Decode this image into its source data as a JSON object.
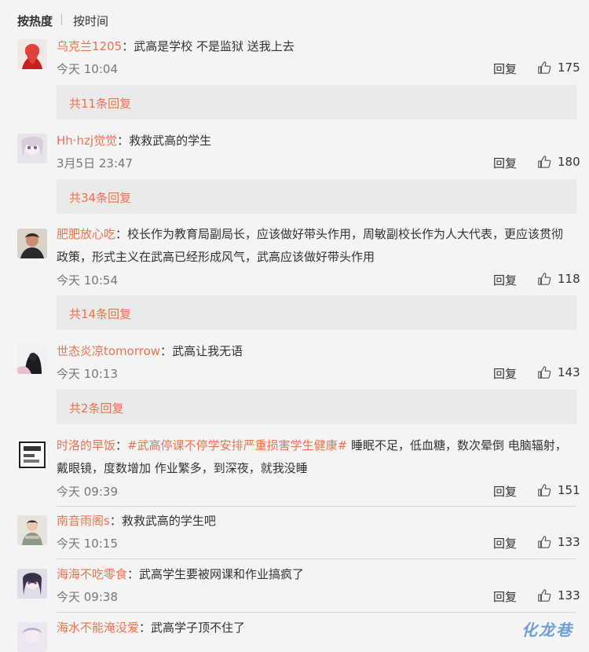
{
  "sort": {
    "hot": "按热度",
    "time": "按时间"
  },
  "reply_label": "回复",
  "icons": {
    "like": "thumbs-up-icon"
  },
  "colors": {
    "username": "#eb7350",
    "replies_bg": "#eaeaea",
    "background": "#f4f4f4"
  },
  "comments": [
    {
      "user": "乌克兰1205",
      "text": "武高是学校 不是监狱 送我上去",
      "time": "今天 10:04",
      "likes": "175",
      "replies": "共11条回复"
    },
    {
      "user": "Hh·hzj觉觉",
      "text": "救救武高的学生",
      "time": "3月5日 23:47",
      "likes": "180",
      "replies": "共34条回复"
    },
    {
      "user": "肥肥放心吃",
      "text_line1": "校长作为教育局副局长，应该做好带头作用，周敏副校长作为人大代表，更应该贯彻",
      "text_line2": "政策，形式主义在武高已经形成风气，武高应该做好带头作用",
      "time": "今天 10:54",
      "likes": "118",
      "replies": "共14条回复"
    },
    {
      "user": "世态炎凉tomorrow",
      "text": "武高让我无语",
      "time": "今天 10:13",
      "likes": "143",
      "replies": "共2条回复"
    },
    {
      "user": "时洛的早饭",
      "hashtag": "#武高停课不停学安排严重损害学生健康#",
      "text_line1": " 睡眠不足，低血糖，数次晕倒 电脑辐射，",
      "text_line2": "戴眼镜，度数增加 作业繁多，到深夜，就我没睡",
      "time": "今天 09:39",
      "likes": "151"
    },
    {
      "user": "南音雨阁s",
      "text": "救救武高的学生吧",
      "time": "今天 10:15",
      "likes": "133"
    },
    {
      "user": "海海不吃零食",
      "text": "武高学生要被网课和作业搞疯了",
      "time": "今天 09:38",
      "likes": "133"
    },
    {
      "user": "海水不能淹没爱",
      "text": "武高学子顶不住了"
    }
  ],
  "watermark": "化龙巷"
}
